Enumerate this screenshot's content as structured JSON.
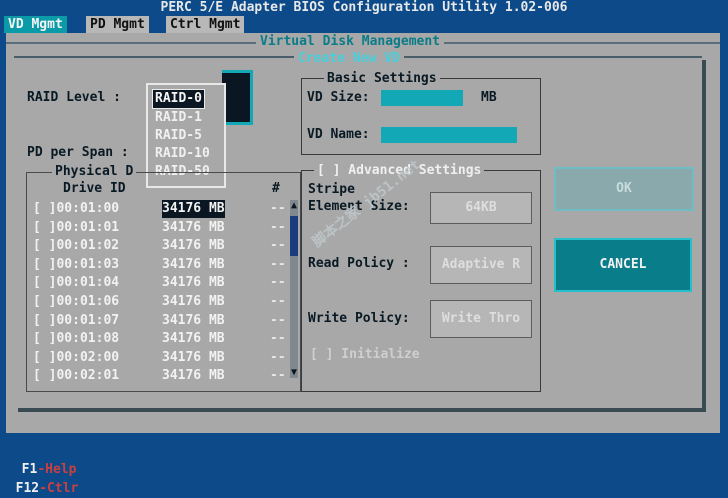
{
  "window": {
    "title": "PERC 5/E Adapter BIOS Configuration Utility 1.02-006"
  },
  "menu": {
    "items": [
      {
        "label": "VD Mgmt",
        "active": true
      },
      {
        "label": "PD Mgmt",
        "active": false
      },
      {
        "label": "Ctrl Mgmt",
        "active": false
      }
    ]
  },
  "frame": {
    "title": "Virtual Disk Management"
  },
  "dialog": {
    "title": "Create New VD",
    "raid_level_label": "RAID Level :",
    "raid_options": [
      "RAID-0",
      "RAID-1",
      "RAID-5",
      "RAID-10",
      "RAID-50"
    ],
    "raid_selected": "RAID-0",
    "pd_per_span_label": "PD per Span :",
    "physical_disks": {
      "title": "Physical D",
      "col_drive_id": "Drive ID",
      "col_hash": "#",
      "rows": [
        {
          "id": "[ ]00:01:00",
          "size": "34176 MB",
          "hash": "--",
          "highlight": true
        },
        {
          "id": "[ ]00:01:01",
          "size": "34176 MB",
          "hash": "--",
          "highlight": false
        },
        {
          "id": "[ ]00:01:02",
          "size": "34176 MB",
          "hash": "--",
          "highlight": false
        },
        {
          "id": "[ ]00:01:03",
          "size": "34176 MB",
          "hash": "--",
          "highlight": false
        },
        {
          "id": "[ ]00:01:04",
          "size": "34176 MB",
          "hash": "--",
          "highlight": false
        },
        {
          "id": "[ ]00:01:06",
          "size": "34176 MB",
          "hash": "--",
          "highlight": false
        },
        {
          "id": "[ ]00:01:07",
          "size": "34176 MB",
          "hash": "--",
          "highlight": false
        },
        {
          "id": "[ ]00:01:08",
          "size": "34176 MB",
          "hash": "--",
          "highlight": false
        },
        {
          "id": "[ ]00:02:00",
          "size": "34176 MB",
          "hash": "--",
          "highlight": false
        },
        {
          "id": "[ ]00:02:01",
          "size": "34176 MB",
          "hash": "--",
          "highlight": false
        }
      ]
    },
    "basic_settings": {
      "title": "Basic Settings",
      "vd_size_label": "VD Size:",
      "vd_size_value": "",
      "vd_size_unit": "MB",
      "vd_name_label": "VD Name:",
      "vd_name_value": ""
    },
    "advanced_settings": {
      "title": "[ ] Advanced Settings",
      "stripe_label_1": "Stripe",
      "stripe_label_2": "Element Size:",
      "stripe_value": "64KB",
      "read_policy_label": "Read Policy :",
      "read_policy_value": "Adaptive R",
      "write_policy_label": "Write Policy:",
      "write_policy_value": "Write Thro",
      "initialize_label": "[ ] Initialize"
    },
    "ok_label": "OK",
    "cancel_label": "CANCEL"
  },
  "status_bar": {
    "keys": [
      {
        "key": "F1",
        "desc": "-Help"
      },
      {
        "key": "F12",
        "desc": "-Ctlr"
      }
    ]
  },
  "watermark": "脚本之家 jb51.net",
  "colors": {
    "background": "#0c4a8a",
    "panel": "#a8a8a8",
    "teal": "#12a8b6",
    "highlight": "#0a1622"
  }
}
